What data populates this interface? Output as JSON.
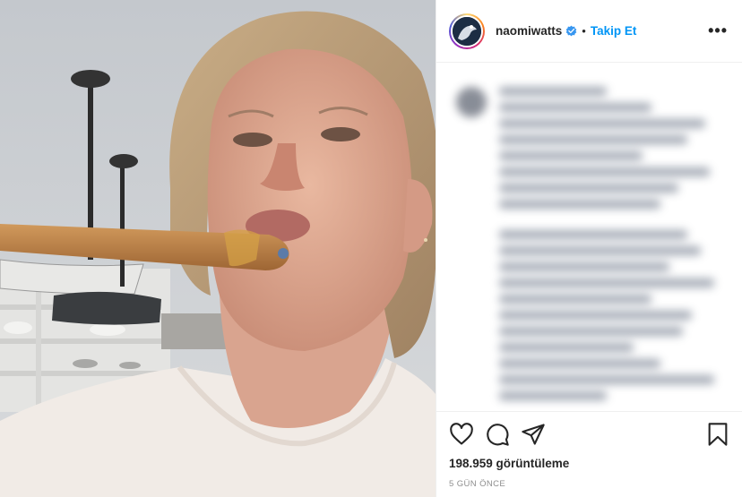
{
  "post": {
    "username": "naomiwatts",
    "separator": "•",
    "follow_label": "Takip Et",
    "more_label": "•••",
    "views": "198.959 görüntüleme",
    "time_ago": "5 GÜN ÖNCE"
  },
  "colors": {
    "accent": "#0095f6",
    "text": "#262626",
    "muted": "#8e8e8e",
    "verified": "#3897f0"
  },
  "icons": {
    "like": "heart-icon",
    "comment": "comment-icon",
    "share": "paper-plane-icon",
    "save": "bookmark-icon",
    "verified": "verified-badge-icon",
    "more": "more-options-icon"
  }
}
